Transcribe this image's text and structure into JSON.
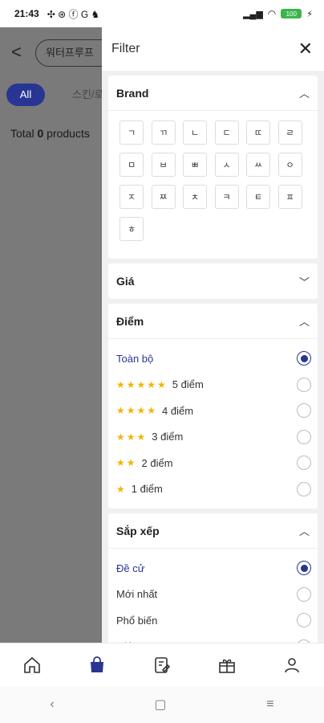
{
  "status_bar": {
    "time": "21:43",
    "battery": "100"
  },
  "background": {
    "search_value": "워터프루프",
    "tabs": [
      "All",
      "스킨/로"
    ],
    "total_prefix": "Total ",
    "total_count": "0",
    "total_suffix": " products"
  },
  "drawer": {
    "title": "Filter",
    "brand": {
      "title": "Brand",
      "chips": [
        "ㄱ",
        "ㄲ",
        "ㄴ",
        "ㄷ",
        "ㄸ",
        "ㄹ",
        "ㅁ",
        "ㅂ",
        "ㅃ",
        "ㅅ",
        "ㅆ",
        "ㅇ",
        "ㅈ",
        "ㅉ",
        "ㅊ",
        "ㅋ",
        "ㅌ",
        "ㅍ",
        "ㅎ"
      ]
    },
    "price": {
      "title": "Giá"
    },
    "rating": {
      "title": "Điểm",
      "options": [
        {
          "label": "Toàn bộ",
          "stars": 0,
          "selected": true
        },
        {
          "label": "5 điểm",
          "stars": 5,
          "selected": false
        },
        {
          "label": "4 điểm",
          "stars": 4,
          "selected": false
        },
        {
          "label": "3 điểm",
          "stars": 3,
          "selected": false
        },
        {
          "label": "2 điểm",
          "stars": 2,
          "selected": false
        },
        {
          "label": "1 điểm",
          "stars": 1,
          "selected": false
        }
      ]
    },
    "sort": {
      "title": "Sắp xếp",
      "options": [
        {
          "label": "Đề cử",
          "selected": true
        },
        {
          "label": "Mới nhất",
          "selected": false
        },
        {
          "label": "Phổ biến",
          "selected": false
        },
        {
          "label": "Giá cao",
          "selected": false
        }
      ]
    }
  },
  "bottom_nav": [
    "home-icon",
    "shopping-bag-icon",
    "notes-icon",
    "gift-icon",
    "profile-icon"
  ],
  "colors": {
    "accent": "#283593",
    "star": "#f5b400",
    "overlay": "#7a7a7a"
  }
}
